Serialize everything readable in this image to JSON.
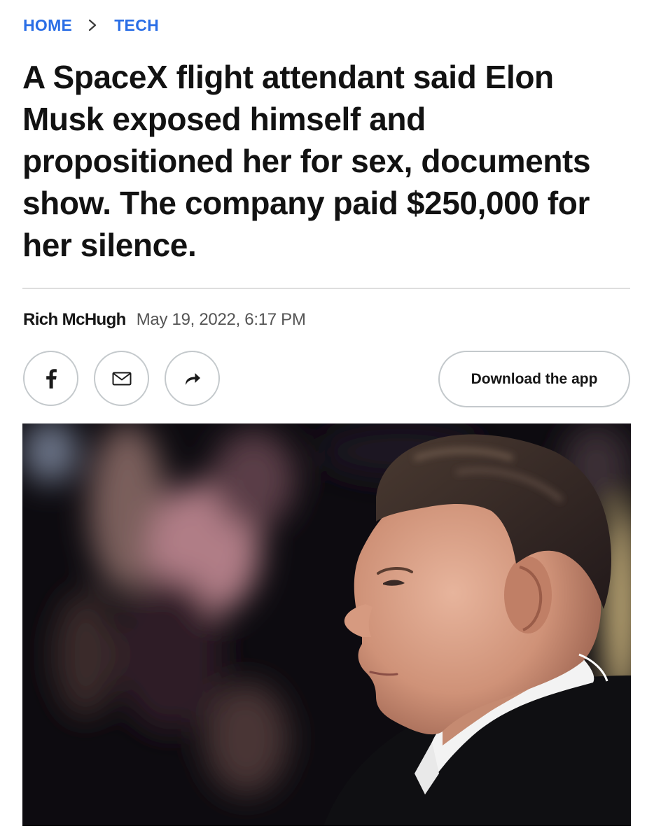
{
  "breadcrumb": {
    "items": [
      {
        "label": "HOME"
      },
      {
        "label": "TECH"
      }
    ],
    "separator": ">"
  },
  "article": {
    "headline": "A SpaceX flight attendant said Elon Musk exposed himself and propositioned her for sex, documents show. The company paid $250,000 for her silence.",
    "author": "Rich McHugh",
    "date": "May 19, 2022, 6:17 PM"
  },
  "share": {
    "buttons": [
      {
        "icon": "facebook-icon"
      },
      {
        "icon": "mail-icon"
      },
      {
        "icon": "share-arrow-icon"
      }
    ]
  },
  "cta": {
    "download_label": "Download the app"
  },
  "hero_image": {
    "subject": "photo-of-man-in-profile"
  },
  "colors": {
    "link_blue": "#2a6ee6",
    "headline": "#121212",
    "byline_date": "#555555",
    "border": "#c4c9cc",
    "divider": "#dedede"
  }
}
